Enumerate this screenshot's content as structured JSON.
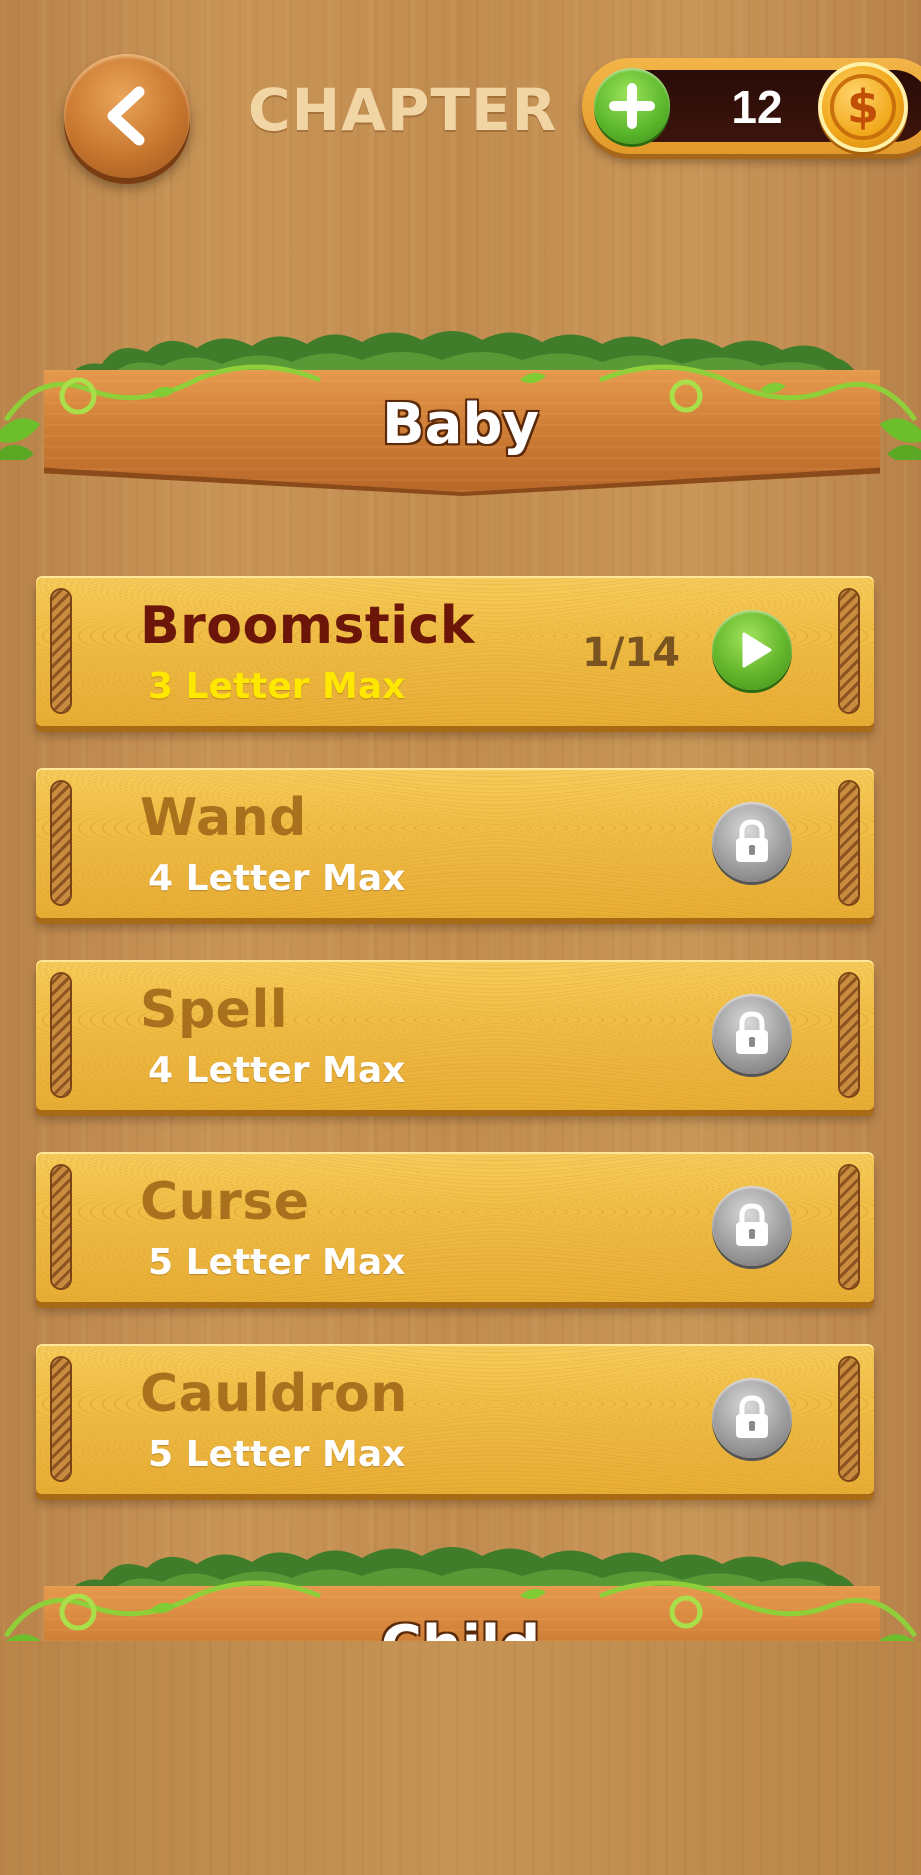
{
  "header": {
    "back_icon": "chevron-left-icon",
    "title": "CHAPTER",
    "coins": {
      "add_icon": "plus-icon",
      "count": "12",
      "coin_icon": "dollar-coin-icon",
      "coin_symbol": "$"
    }
  },
  "sections": [
    {
      "title": "Baby"
    },
    {
      "title": "Child"
    }
  ],
  "levels": [
    {
      "name": "Broomstick",
      "subtitle": "3 Letter Max",
      "progress": "1/14",
      "state": "unlocked",
      "action_icon": "play-icon"
    },
    {
      "name": "Wand",
      "subtitle": "4 Letter Max",
      "state": "locked",
      "action_icon": "lock-icon"
    },
    {
      "name": "Spell",
      "subtitle": "4 Letter Max",
      "state": "locked",
      "action_icon": "lock-icon"
    },
    {
      "name": "Curse",
      "subtitle": "5 Letter Max",
      "state": "locked",
      "action_icon": "lock-icon"
    },
    {
      "name": "Cauldron",
      "subtitle": "5 Letter Max",
      "state": "locked",
      "action_icon": "lock-icon"
    }
  ],
  "colors": {
    "active_name": "#6b1608",
    "active_subtitle": "#ffe800",
    "locked_name": "#a9701e",
    "plank": "#f0bd45",
    "play_button": "#62b52b",
    "lock_button": "#9e9e9e"
  }
}
